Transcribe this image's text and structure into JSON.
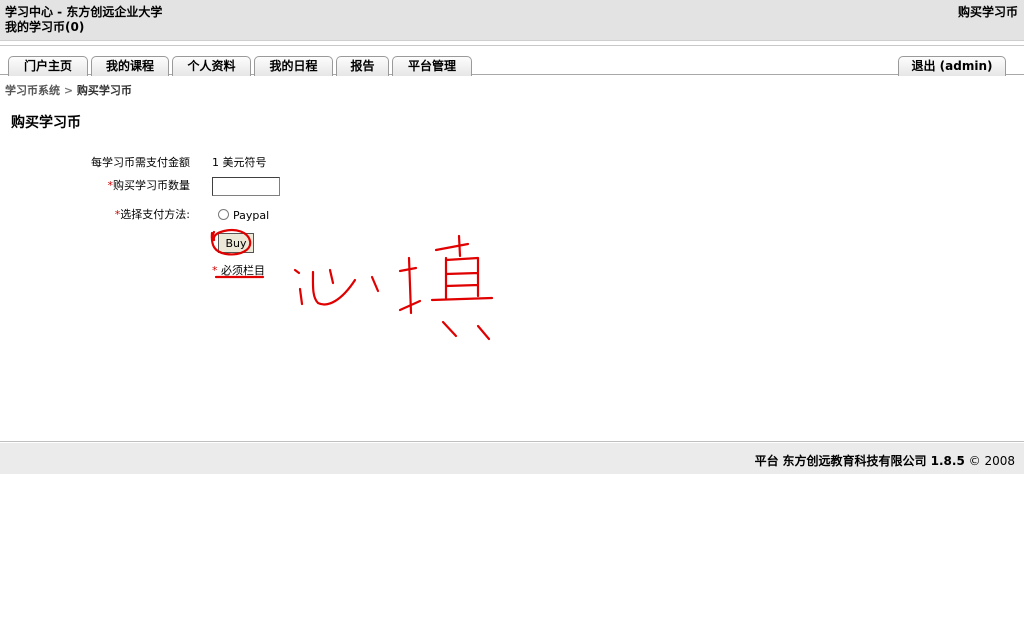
{
  "header": {
    "title": "学习中心 - 东方创远企业大学",
    "coins": "我的学习币(0)",
    "right_link": "购买学习币"
  },
  "tabs": [
    {
      "label": "门户主页"
    },
    {
      "label": "我的课程"
    },
    {
      "label": "个人资料"
    },
    {
      "label": "我的日程"
    },
    {
      "label": "报告"
    },
    {
      "label": "平台管理"
    }
  ],
  "logout_tab": "退出 (admin)",
  "breadcrumb": {
    "parent": "学习币系统",
    "separator": ">",
    "current": "购买学习币"
  },
  "page_title": "购买学习币",
  "form": {
    "price_label": "每学习币需支付金额",
    "price_value": "1 美元符号",
    "qty_label": "购买学习币数量",
    "qty_value": "",
    "payment_label": "选择支付方法:",
    "payment_option": "Paypal",
    "buy_button": "Buy",
    "required_mark": "*",
    "required_note": "必须栏目"
  },
  "footer": {
    "prefix": "平台",
    "company": "东方创远教育科技有限公司 1.8.5",
    "suffix": "© 2008"
  },
  "colors": {
    "annotation": "#e00000",
    "required": "#cc0000"
  }
}
